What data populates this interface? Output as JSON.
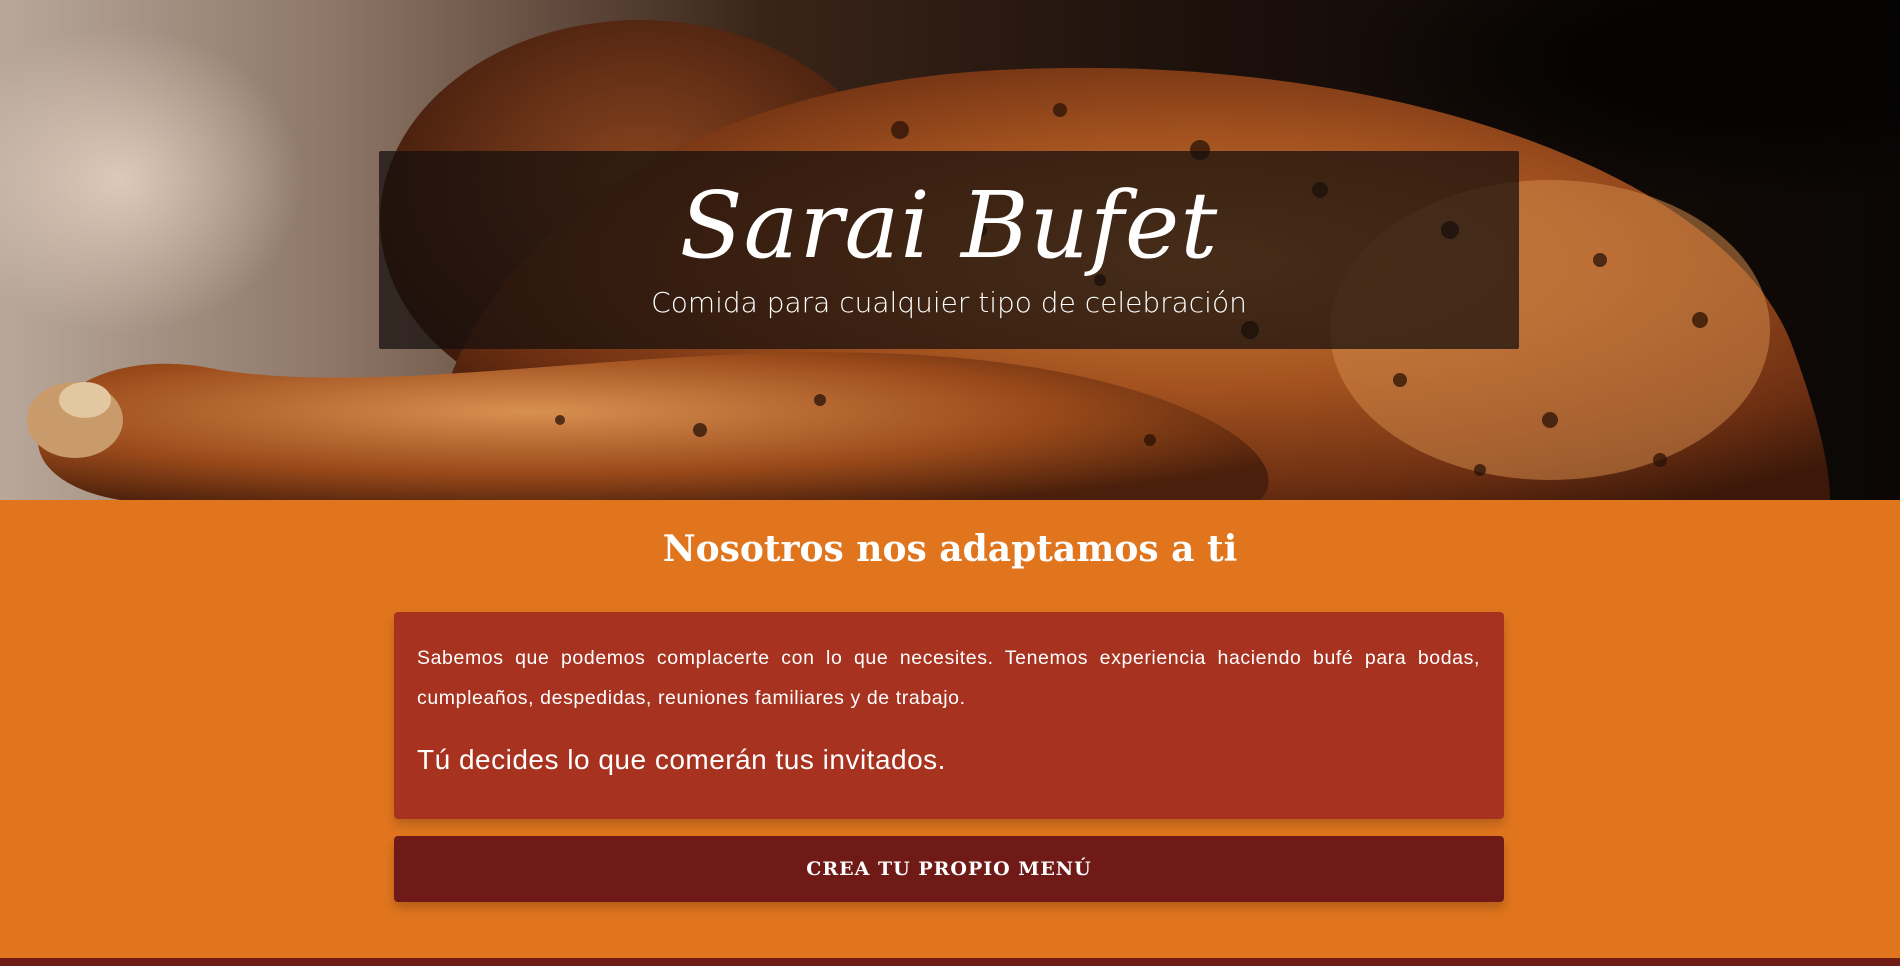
{
  "hero": {
    "title": "Sarai Bufet",
    "subtitle": "Comida para cualquier tipo de celebración",
    "image": "roast-chicken-photo"
  },
  "section": {
    "heading": "Nosotros nos adaptamos a ti",
    "paragraph": "Sabemos que podemos complacerte con lo que necesites. Tenemos experiencia haciendo bufé para bodas, cumpleaños, despedidas, reuniones familiares y de trabajo.",
    "highlight": "Tú decides lo que comerán tus invitados.",
    "cta_label": "CREA TU PROPIO MENÚ"
  },
  "colors": {
    "accent": "#e0751e",
    "card": "#a83220",
    "button": "#701a17",
    "overlay": "#140e0c"
  }
}
